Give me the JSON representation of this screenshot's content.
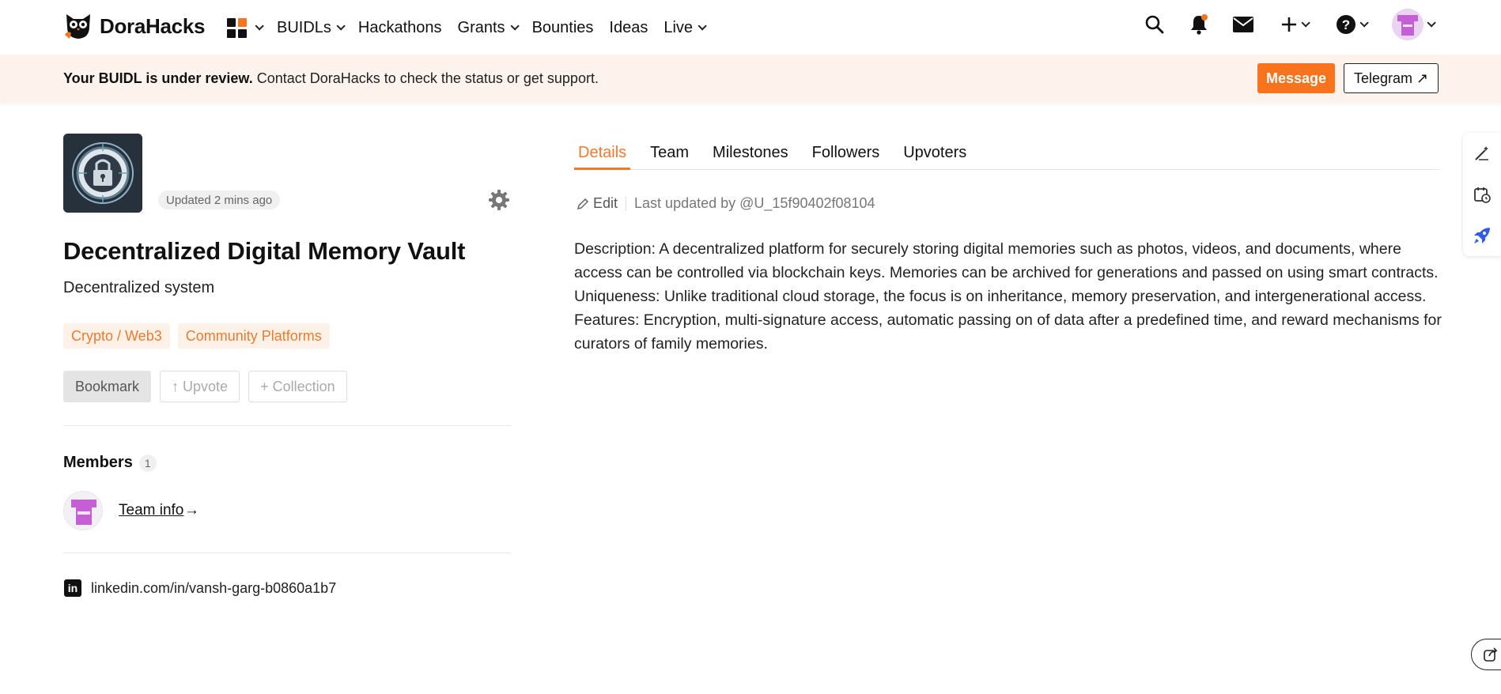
{
  "header": {
    "brand": "DoraHacks",
    "nav": [
      "BUIDLs",
      "Hackathons",
      "Grants",
      "Bounties",
      "Ideas",
      "Live"
    ],
    "accent": "#f7731e"
  },
  "banner": {
    "bold": "Your BUIDL is under review.",
    "text": " Contact DoraHacks to check the status or get support.",
    "message_label": "Message",
    "telegram_label": "Telegram ↗"
  },
  "project": {
    "updated": "Updated 2 mins ago",
    "title": "Decentralized Digital Memory Vault",
    "subtitle": "Decentralized system",
    "tags": [
      "Crypto / Web3",
      "Community Platforms"
    ],
    "actions": {
      "bookmark": "Bookmark",
      "upvote": "↑ Upvote",
      "collection": "+ Collection"
    },
    "members_label": "Members",
    "members_count": "1",
    "team_info": "Team info",
    "team_arrow": "→",
    "linkedin": "linkedin.com/in/vansh-garg-b0860a1b7"
  },
  "tabs": [
    "Details",
    "Team",
    "Milestones",
    "Followers",
    "Upvoters"
  ],
  "details": {
    "edit_label": "Edit",
    "last_updated": "Last updated by @U_15f90402f08104",
    "description": "Description: A decentralized platform for securely storing digital memories such as photos, videos, and documents, where access can be controlled via blockchain keys. Memories can be archived for generations and passed on using smart contracts. Uniqueness: Unlike traditional cloud storage, the focus is on inheritance, memory preservation, and intergenerational access. Features: Encryption, multi-signature access, automatic passing on of data after a predefined time, and reward mechanisms for curators of family memories."
  }
}
